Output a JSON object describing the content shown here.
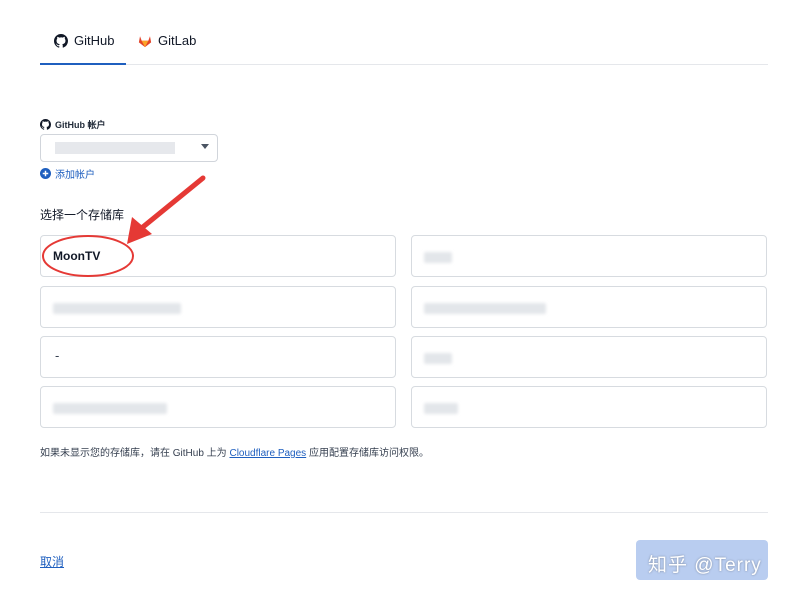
{
  "tabs": [
    {
      "label": "GitHub",
      "icon": "github-icon",
      "active": true
    },
    {
      "label": "GitLab",
      "icon": "gitlab-icon",
      "active": false
    }
  ],
  "account": {
    "label": "GitHub 帐户",
    "add_label": "添加帐户"
  },
  "repos": {
    "heading": "选择一个存储库",
    "items": [
      {
        "name": "MoonTV"
      },
      {
        "name": ""
      },
      {
        "name": ""
      },
      {
        "name": ""
      },
      {
        "name": "-"
      },
      {
        "name": ""
      },
      {
        "name": ""
      },
      {
        "name": ""
      }
    ]
  },
  "hint": {
    "before": "如果未显示您的存储库，请在 GitHub 上为",
    "link": "Cloudflare Pages",
    "after": "应用配置存储库访问权限。"
  },
  "footer": {
    "cancel_label": "取消",
    "watermark": "知乎 @Terry"
  },
  "colors": {
    "accent": "#1f5fbf",
    "annotation_red": "#e53935",
    "disabled_button": "#b9cdf0",
    "gitlab_orange": "#e24329"
  }
}
